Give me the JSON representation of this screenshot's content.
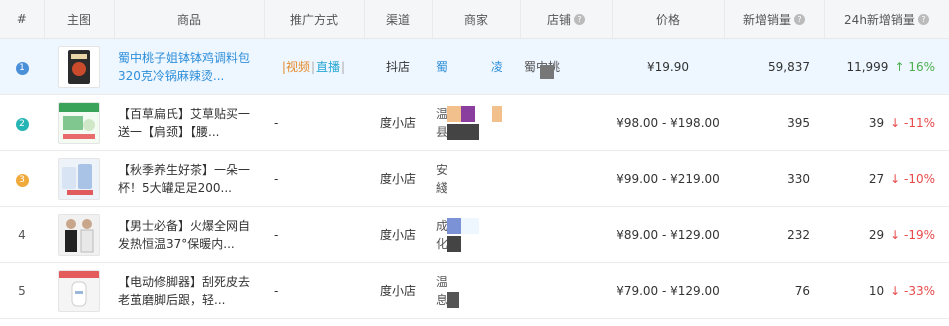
{
  "header": {
    "index": "#",
    "image": "主图",
    "product": "商品",
    "promo": "推广方式",
    "channel": "渠道",
    "merchant": "商家",
    "store": "店铺",
    "price": "价格",
    "sales": "新增销量",
    "sales24": "24h新增销量"
  },
  "rows": [
    {
      "rank": "1",
      "rank_color": "#4a90d9",
      "title": "蜀中桃子姐钵钵鸡调料包320克冷锅麻辣烫...",
      "promo_video": "视频",
      "promo_sep": "|",
      "promo_live": "直播",
      "channel": "抖店",
      "merchant_a": "蜀",
      "merchant_b": "凌",
      "store": "蜀中桃",
      "price": "¥19.90",
      "sales": "59,837",
      "sales24": "11,999",
      "trend_arrow": "↑",
      "trend_pct": "16%"
    },
    {
      "rank": "2",
      "rank_color": "#26b5b5",
      "title": "【百草扁氏】艾草贴买一送一【肩颈】【腰...",
      "promo": "-",
      "channel": "度小店",
      "merchant_a": "温",
      "merchant_b": "县",
      "price": "¥98.00 - ¥198.00",
      "sales": "395",
      "sales24": "39",
      "trend_arrow": "↓",
      "trend_pct": "-11%"
    },
    {
      "rank": "3",
      "rank_color": "#f0a93b",
      "title": "【秋季养生好茶】一朵一杯！5大罐足足200...",
      "promo": "-",
      "channel": "度小店",
      "merchant_a": "安",
      "merchant_b": "綫",
      "price": "¥99.00 - ¥219.00",
      "sales": "330",
      "sales24": "27",
      "trend_arrow": "↓",
      "trend_pct": "-10%"
    },
    {
      "rank": "4",
      "title": "【男士必备】火爆全网自发热恒温37°保暖内...",
      "promo": "-",
      "channel": "度小店",
      "merchant_a": "成",
      "merchant_b": "化",
      "price": "¥89.00 - ¥129.00",
      "sales": "232",
      "sales24": "29",
      "trend_arrow": "↓",
      "trend_pct": "-19%"
    },
    {
      "rank": "5",
      "title": "【电动修脚器】刮死皮去老茧磨脚后跟，轻...",
      "promo": "-",
      "channel": "度小店",
      "merchant_a": "温",
      "merchant_b": "息",
      "price": "¥79.00 - ¥129.00",
      "sales": "76",
      "sales24": "10",
      "trend_arrow": "↓",
      "trend_pct": "-33%"
    }
  ],
  "icons": {
    "info": "question-info-icon"
  },
  "colors": {
    "up": "#4caf50",
    "down": "#e84a4a",
    "link": "#2f8fd9",
    "highlight_row": "#eef6ff"
  }
}
